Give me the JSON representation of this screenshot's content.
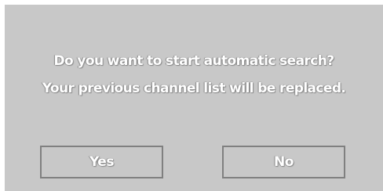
{
  "dialog": {
    "message_line1": "Do you want to start automatic search?",
    "message_line2": "Your previous channel list will be replaced.",
    "yes_label": "Yes",
    "no_label": "No"
  },
  "colors": {
    "dialog_background": "#c8c8c8",
    "button_border": "#808080",
    "text": "#ffffff"
  }
}
